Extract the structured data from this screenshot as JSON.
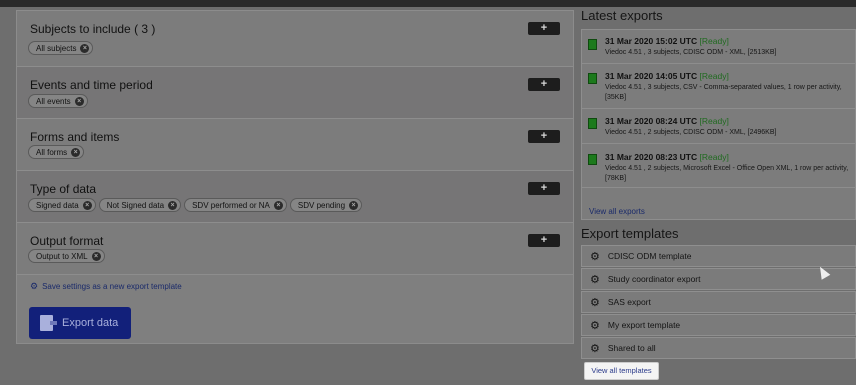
{
  "sections": {
    "subjects": {
      "title": "Subjects to include ( 3 )",
      "tags": [
        "All subjects"
      ]
    },
    "events": {
      "title": "Events and time period",
      "tags": [
        "All events"
      ]
    },
    "forms": {
      "title": "Forms and items",
      "tags": [
        "All forms"
      ]
    },
    "type": {
      "title": "Type of data",
      "tags": [
        "Signed data",
        "Not Signed data",
        "SDV performed or NA",
        "SDV pending"
      ]
    },
    "output": {
      "title": "Output format",
      "tags": [
        "Output to XML"
      ]
    }
  },
  "plus_label": "+",
  "remove_glyph": "×",
  "save_settings_label": "Save settings as a new export template",
  "export_button_label": "Export data",
  "latest_exports": {
    "heading": "Latest exports",
    "items": [
      {
        "date": "31 Mar 2020 15:02 UTC",
        "status": "[Ready]",
        "desc": "Viedoc 4.51 , 3 subjects, CDISC ODM - XML, [2513KB]"
      },
      {
        "date": "31 Mar 2020 14:05 UTC",
        "status": "[Ready]",
        "desc": "Viedoc 4.51 , 3 subjects, CSV - Comma-separated values, 1 row per activity, [35KB]"
      },
      {
        "date": "31 Mar 2020 08:24 UTC",
        "status": "[Ready]",
        "desc": "Viedoc 4.51 , 2 subjects, CDISC ODM - XML, [2496KB]"
      },
      {
        "date": "31 Mar 2020 08:23 UTC",
        "status": "[Ready]",
        "desc": "Viedoc 4.51 , 2 subjects, Microsoft Excel - Office Open XML, 1 row per activity, [78KB]"
      }
    ],
    "view_all": "View all exports"
  },
  "export_templates": {
    "heading": "Export templates",
    "items": [
      "CDISC ODM template",
      "Study coordinator export",
      "SAS export",
      "My export template",
      "Shared to all"
    ],
    "view_all": "View all templates"
  },
  "icons": {
    "gear": "gear-icon",
    "file": "file-icon",
    "export": "export-icon",
    "remove": "remove-tag-icon",
    "cursor": "mouse-cursor-icon"
  }
}
